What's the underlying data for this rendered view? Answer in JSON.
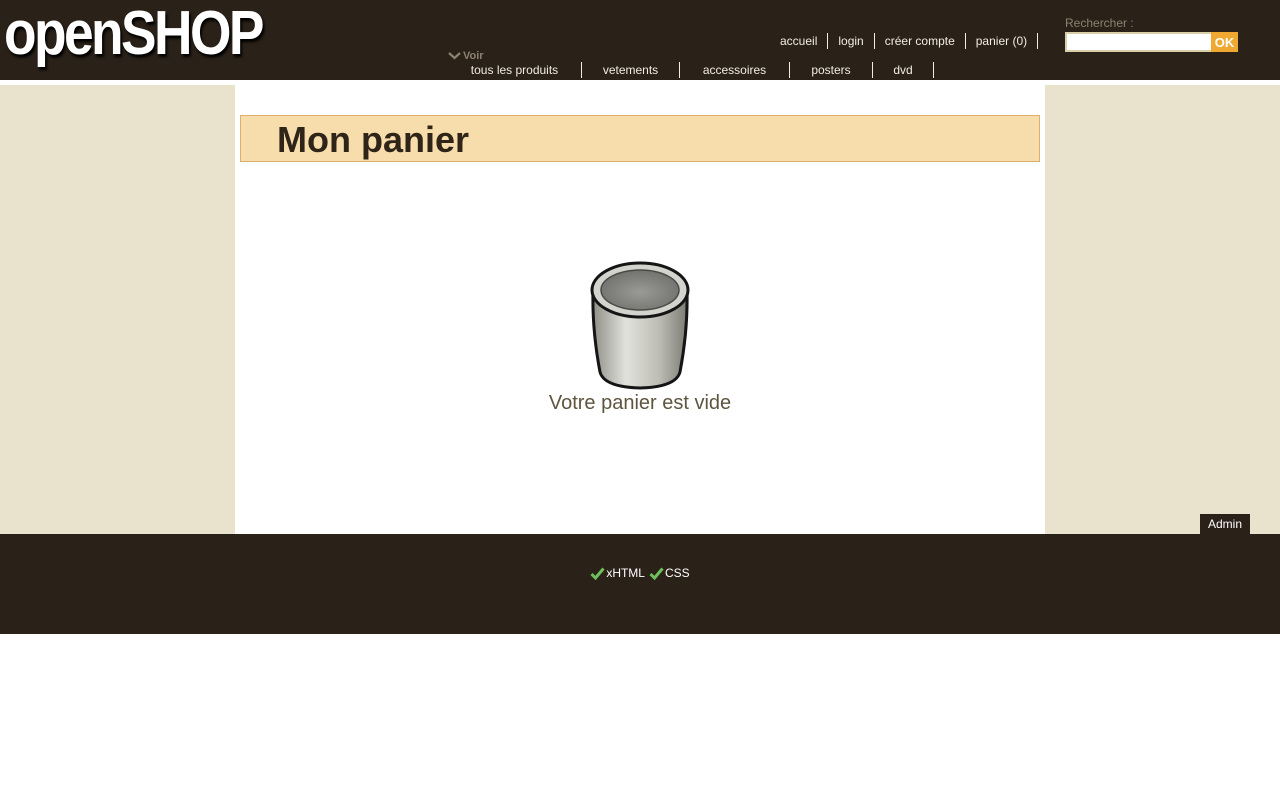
{
  "header": {
    "logo": "openSHOP",
    "topnav": [
      "accueil",
      "login",
      "créer compte",
      "panier (0)"
    ],
    "search": {
      "label": "Rechercher :",
      "value": "",
      "button": "OK"
    },
    "voir_label": "Voir",
    "categories": [
      "tous les produits",
      "vetements",
      "accessoires",
      "posters",
      "dvd"
    ]
  },
  "main": {
    "title": "Mon panier",
    "empty_message": "Votre panier est vide",
    "empty_icon": "trash-bin-icon"
  },
  "admin_label": "Admin",
  "footer": {
    "badges": [
      "xHTML",
      "CSS"
    ],
    "badge_icon": "check-icon"
  },
  "colors": {
    "header_bg": "#2a2118",
    "side_bg": "#e9e3cd",
    "title_bg": "#f7dcac",
    "accent": "#f0a930",
    "check": "#6fbf5a"
  }
}
